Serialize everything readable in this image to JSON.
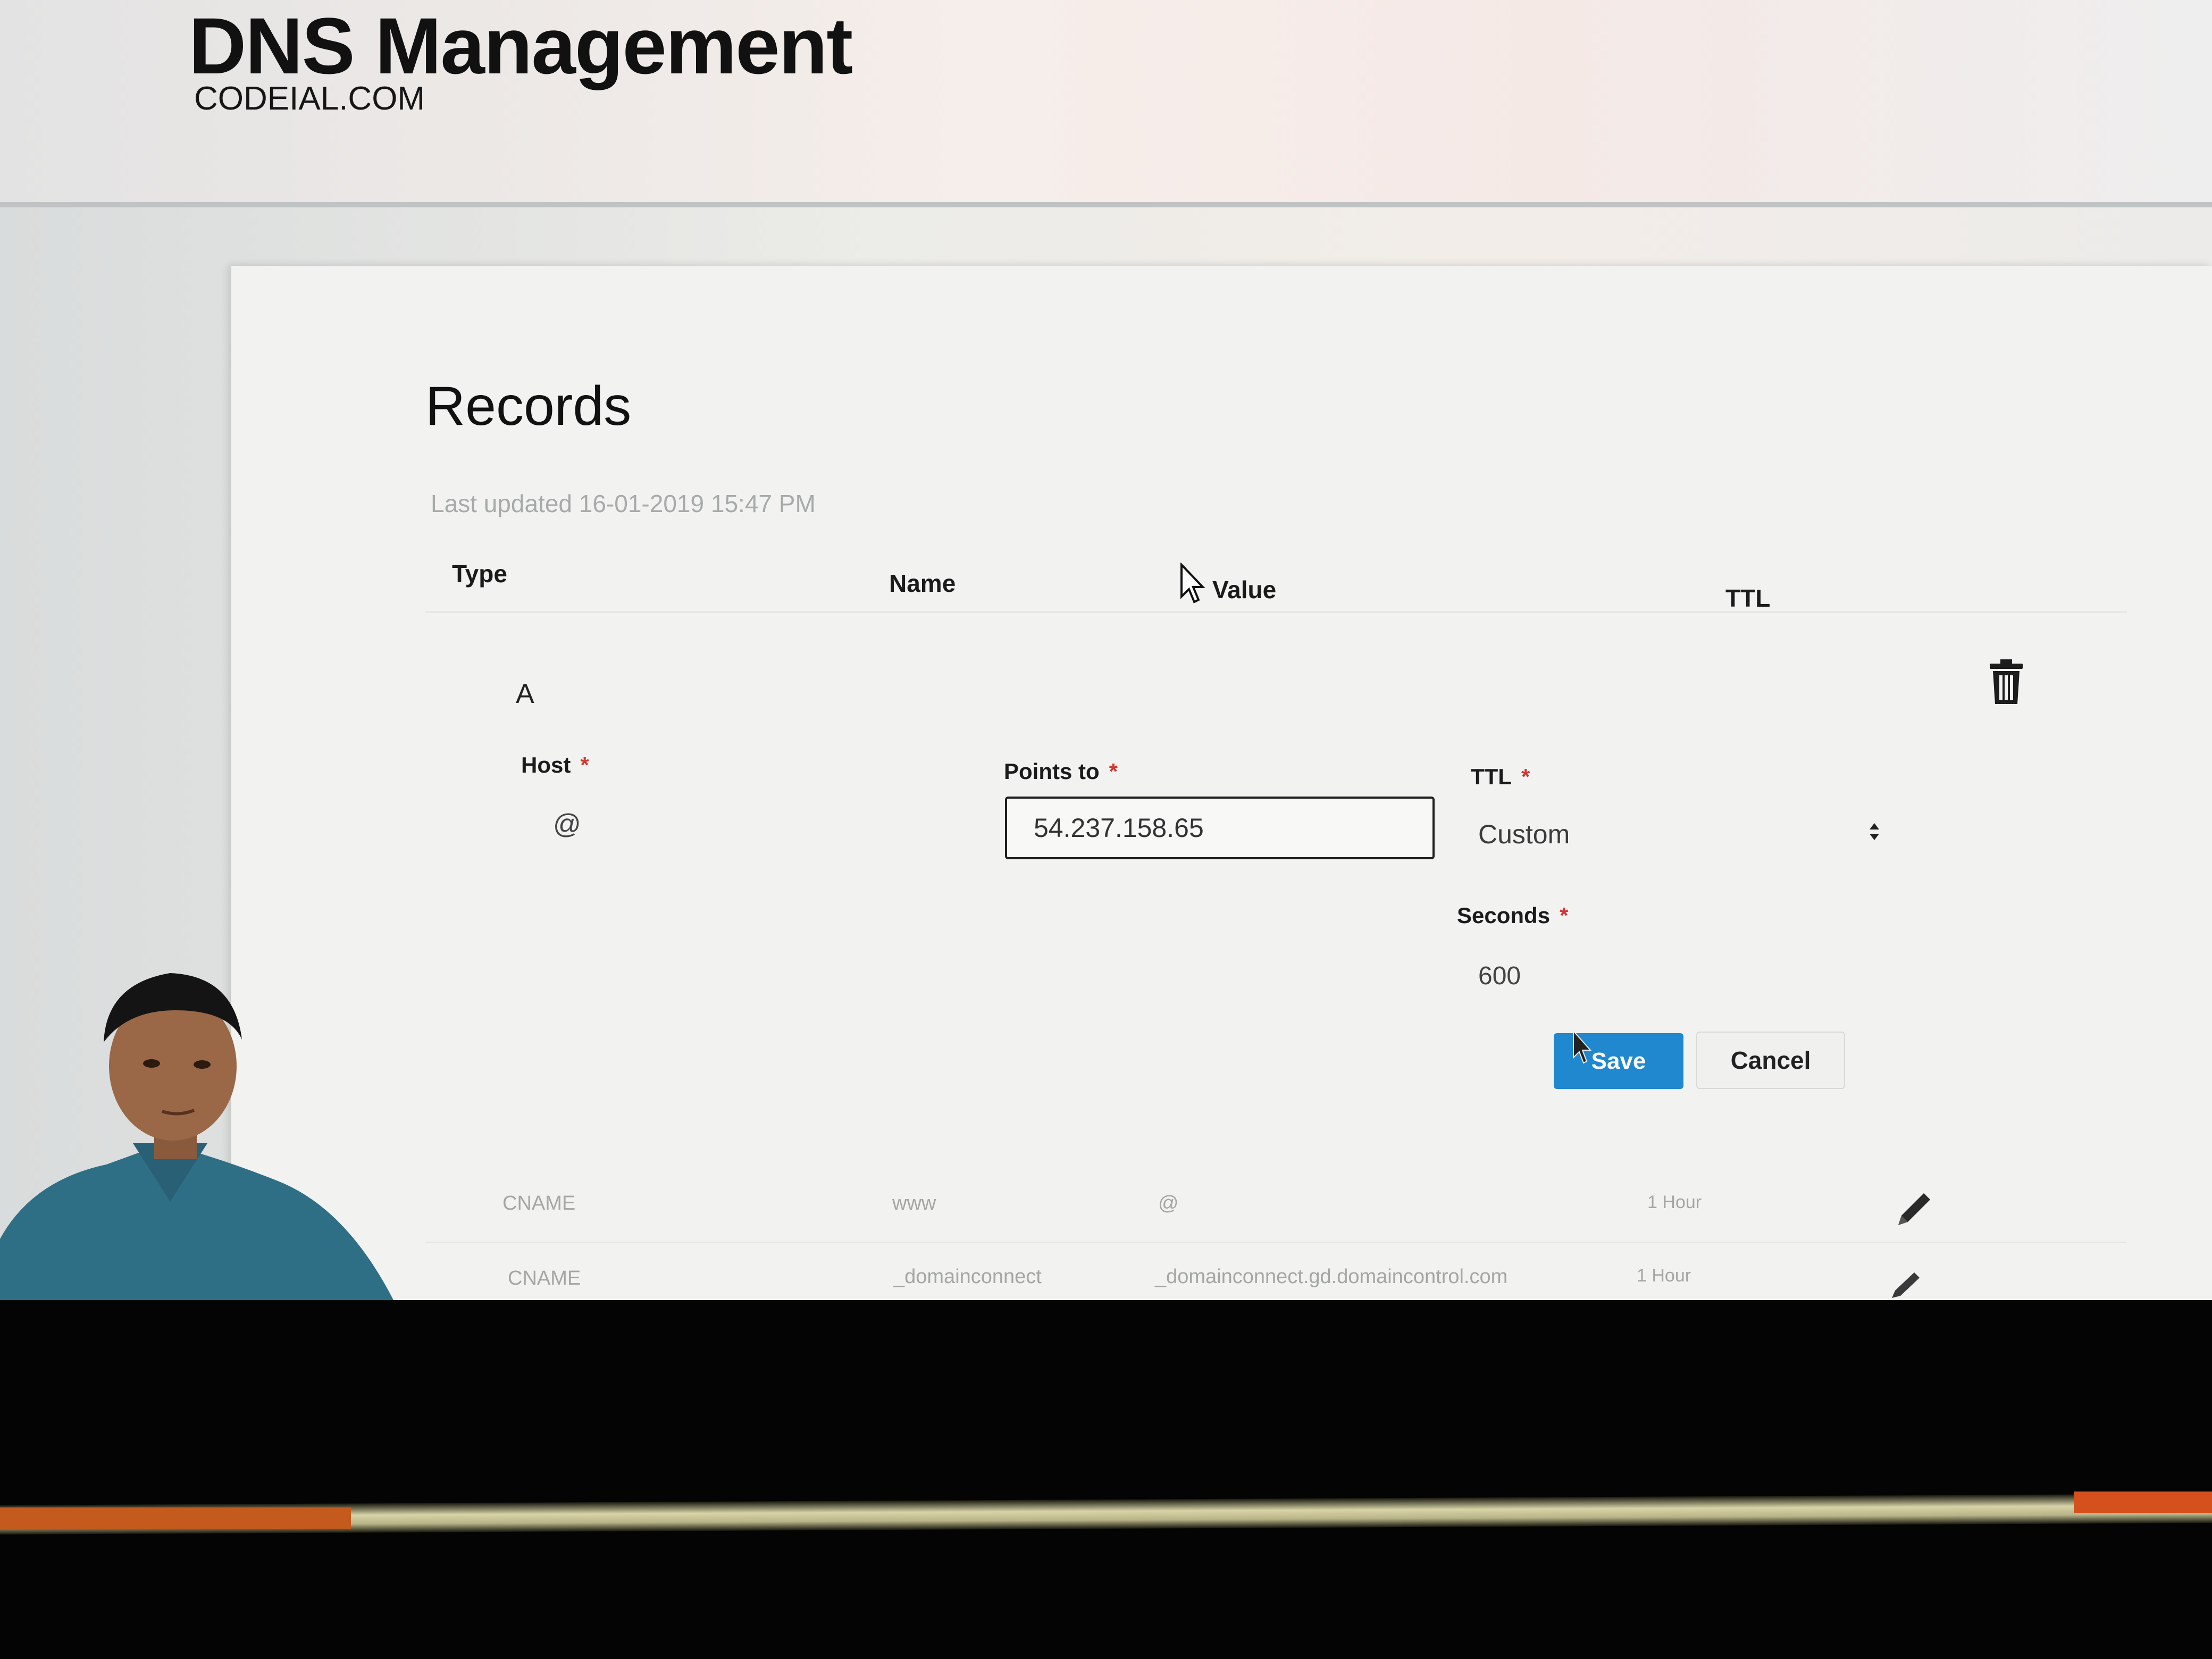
{
  "header": {
    "title": "DNS Management",
    "domain": "CODEIAL.COM"
  },
  "records": {
    "title": "Records",
    "last_updated": "Last updated 16-01-2019 15:47 PM",
    "columns": [
      "Type",
      "Name",
      "Value",
      "TTL"
    ]
  },
  "edit_record": {
    "type": "A",
    "host_label": "Host",
    "host_value": "@",
    "points_to_label": "Points to",
    "points_to_value": "54.237.158.65",
    "ttl_label": "TTL",
    "ttl_value": "Custom",
    "seconds_label": "Seconds",
    "seconds_value": "600",
    "required_marker": "*",
    "save_label": "Save",
    "cancel_label": "Cancel"
  },
  "rows": [
    {
      "type": "CNAME",
      "name": "www",
      "value": "@",
      "ttl": "1 Hour"
    },
    {
      "type": "CNAME",
      "name": "_domainconnect",
      "value": "_domainconnect.gd.domaincontrol.com",
      "ttl": "1 Hour"
    }
  ],
  "colors": {
    "primary_button": "#1f88cf",
    "required": "#d0372f"
  },
  "icons": [
    "trash-icon",
    "pencil-icon",
    "select-arrows-icon",
    "mouse-cursor-icon"
  ]
}
